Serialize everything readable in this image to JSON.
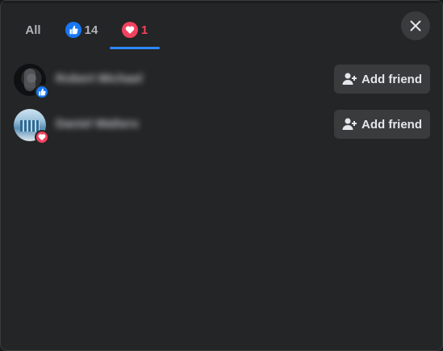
{
  "tabs": {
    "all_label": "All",
    "like_count": "14",
    "love_count": "1"
  },
  "reactors": [
    {
      "name": "Robert Michael",
      "reaction": "like-icon",
      "button_label": "Add friend"
    },
    {
      "name": "Daniel Walters",
      "reaction": "love-icon",
      "button_label": "Add friend"
    }
  ],
  "colors": {
    "like": "#1877f2",
    "love": "#f3425f",
    "active_tab_underline": "#2d88ff",
    "background": "#242526",
    "button": "#3a3b3c"
  }
}
